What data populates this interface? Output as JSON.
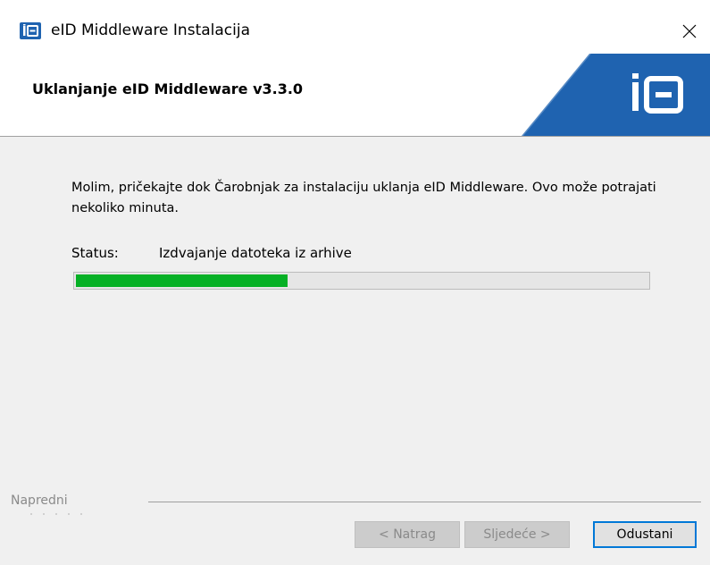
{
  "window": {
    "title": "eID Middleware Instalacija",
    "app_icon": "eid-app-icon",
    "close_icon": "close-icon"
  },
  "header": {
    "title": "Uklanjanje eID Middleware v3.3.0",
    "logo": "ie-logo",
    "accent_color": "#1f63b0"
  },
  "body": {
    "message": "Molim, pričekajte dok Čarobnjak za instalaciju uklanja eID Middleware.  Ovo može potrajati nekoliko minuta.",
    "status_label": "Status:",
    "status_text": "Izdvajanje datoteka iz arhive",
    "progress_percent": 37,
    "progress_color": "#06b025"
  },
  "footer": {
    "advanced_label": "Napredni",
    "back_button": "< Natrag",
    "next_button": "Sljedeće >",
    "cancel_button": "Odustani"
  }
}
